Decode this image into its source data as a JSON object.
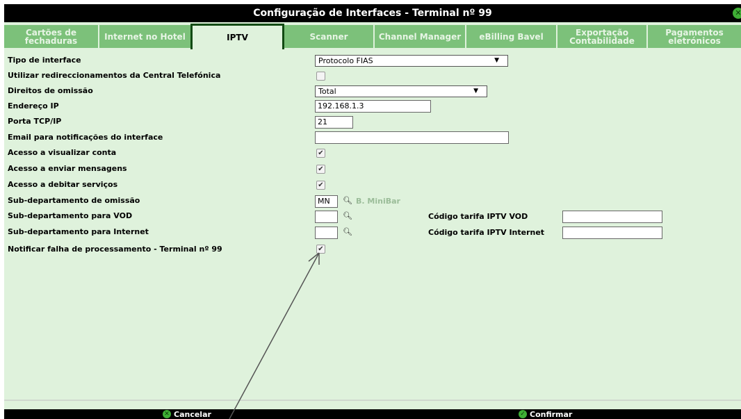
{
  "window": {
    "title": "Configuração de Interfaces - Terminal nº 99"
  },
  "tabs": [
    {
      "label": "Cartões de\nfechaduras"
    },
    {
      "label": "Internet no Hotel"
    },
    {
      "label": "IPTV"
    },
    {
      "label": "Scanner"
    },
    {
      "label": "Channel Manager"
    },
    {
      "label": "eBilling Bavel"
    },
    {
      "label": "Exportação\nContabilidade"
    },
    {
      "label": "Pagamentos\neletrónicos"
    }
  ],
  "form": {
    "tipo_interface": {
      "label": "Tipo de interface",
      "value": "Protocolo FIAS"
    },
    "redireccionamentos": {
      "label": "Utilizar redireccionamentos da Central Telefónica",
      "checked": false
    },
    "direitos": {
      "label": "Direitos de omissão",
      "value": "Total"
    },
    "endereco_ip": {
      "label": "Endereço IP",
      "value": "192.168.1.3"
    },
    "porta": {
      "label": "Porta TCP/IP",
      "value": "21"
    },
    "email": {
      "label": "Email para notificações do interface",
      "value": ""
    },
    "visualizar": {
      "label": "Acesso a visualizar conta",
      "checked": true
    },
    "mensagens": {
      "label": "Acesso a enviar mensagens",
      "checked": true
    },
    "debitar": {
      "label": "Acesso a debitar serviços",
      "checked": true
    },
    "subdep_omissao": {
      "label": "Sub-departamento de omissão",
      "value": "MN",
      "description": "B. MiniBar"
    },
    "subdep_vod": {
      "label": "Sub-departamento para VOD",
      "value": "",
      "tarifa_label": "Código tarifa IPTV VOD",
      "tarifa_value": ""
    },
    "subdep_internet": {
      "label": "Sub-departamento para Internet",
      "value": "",
      "tarifa_label": "Código tarifa IPTV Internet",
      "tarifa_value": ""
    },
    "notificar": {
      "label": "Notificar falha de processamento - Terminal nº 99",
      "checked": true
    }
  },
  "footer": {
    "cancel_label": "Cancelar",
    "confirm_label": "Confirmar"
  },
  "icons": {
    "close": "close-icon",
    "search": "search-icon",
    "check": "check-icon",
    "dropdown": "dropdown-arrow-icon"
  },
  "colors": {
    "tab_bg": "#7cc17a",
    "panel_bg": "#dff2dc",
    "accent_green": "#3fae35",
    "title_bg": "#000000"
  }
}
